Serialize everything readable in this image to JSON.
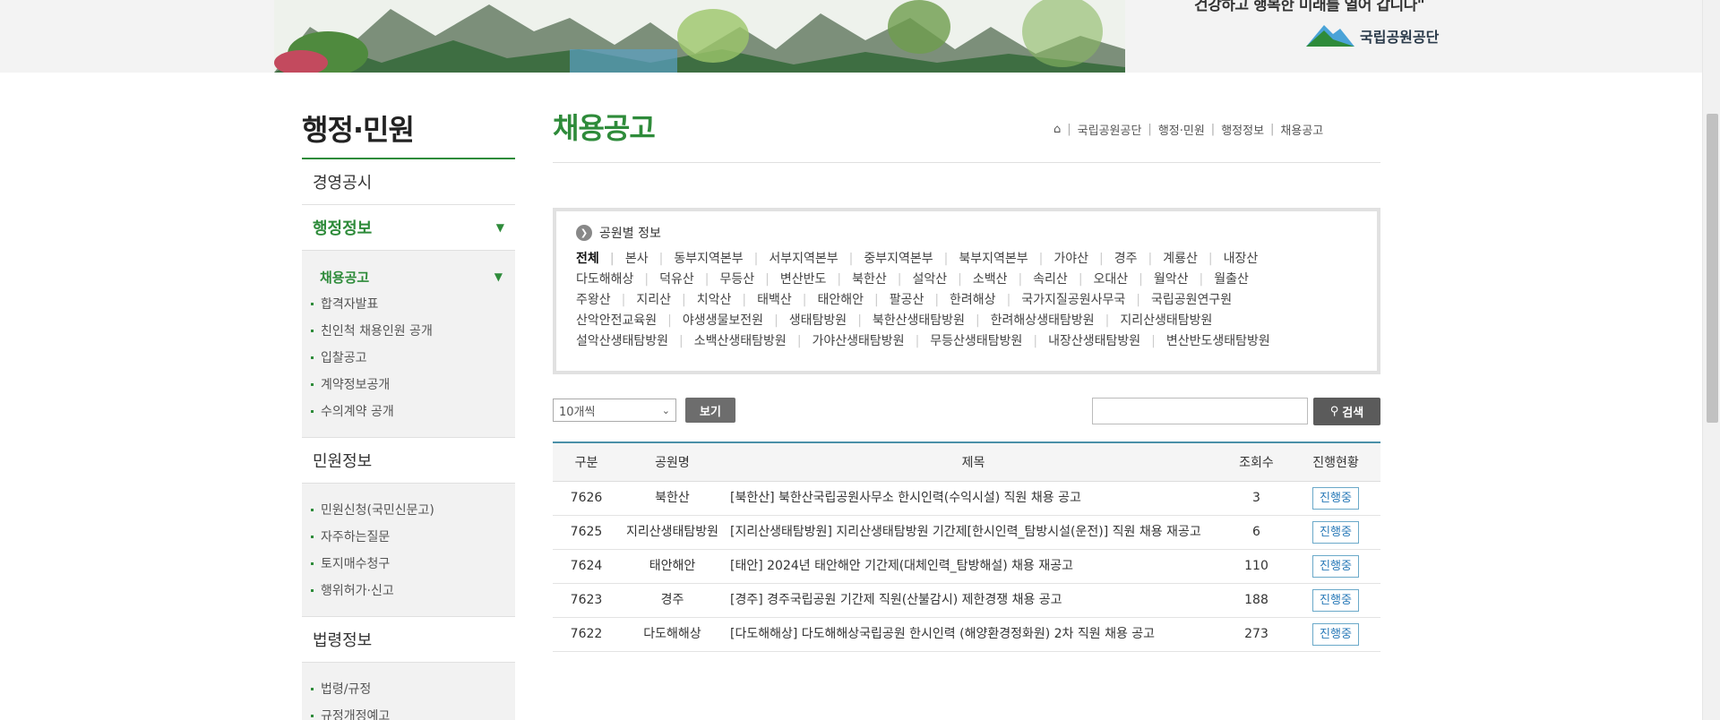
{
  "header": {
    "slogan": "건강하고 행복한 미래를 열어 갑니다\"",
    "logo_text": "국립공원공단"
  },
  "sidebar": {
    "title": "행정·민원",
    "menu": [
      {
        "label": "경영공시"
      },
      {
        "label": "행정정보"
      }
    ],
    "current_sub": "채용공고",
    "admin_items": [
      "합격자발표",
      "친인척 채용인원 공개",
      "입찰공고",
      "계약정보공개",
      "수의계약 공개"
    ],
    "civil_label": "민원정보",
    "civil_items": [
      "민원신청(국민신문고)",
      "자주하는질문",
      "토지매수청구",
      "행위허가·신고"
    ],
    "law_label": "법령정보",
    "law_items": [
      "법령/규정",
      "규정개정예고"
    ]
  },
  "main": {
    "title": "채용공고",
    "breadcrumb": [
      "국립공원공단",
      "행정·민원",
      "행정정보",
      "채용공고"
    ]
  },
  "park_filter": {
    "heading": "공원별 정보",
    "items": [
      "전체",
      "본사",
      "동부지역본부",
      "서부지역본부",
      "중부지역본부",
      "북부지역본부",
      "가야산",
      "경주",
      "계룡산",
      "내장산",
      "다도해해상",
      "덕유산",
      "무등산",
      "변산반도",
      "북한산",
      "설악산",
      "소백산",
      "속리산",
      "오대산",
      "월악산",
      "월출산",
      "주왕산",
      "지리산",
      "치악산",
      "태백산",
      "태안해안",
      "팔공산",
      "한려해상",
      "국가지질공원사무국",
      "국립공원연구원",
      "산악안전교육원",
      "야생생물보전원",
      "생태탐방원",
      "북한산생태탐방원",
      "한려해상생태탐방원",
      "지리산생태탐방원",
      "설악산생태탐방원",
      "소백산생태탐방원",
      "가야산생태탐방원",
      "무등산생태탐방원",
      "내장산생태탐방원",
      "변산반도생태탐방원"
    ],
    "selected": "전체"
  },
  "controls": {
    "page_size": "10개씩",
    "view_label": "보기",
    "search_label": "검색",
    "search_value": ""
  },
  "table": {
    "headers": [
      "구분",
      "공원명",
      "제목",
      "조회수",
      "진행현황"
    ],
    "rows": [
      {
        "no": "7626",
        "park": "북한산",
        "title": "[북한산] 북한산국립공원사무소 한시인력(수익시설) 직원 채용 공고",
        "views": "3",
        "status": "진행중"
      },
      {
        "no": "7625",
        "park": "지리산생태탐방원",
        "title": "[지리산생태탐방원] 지리산생태탐방원 기간제[한시인력_탐방시설(운전)] 직원 채용 재공고",
        "views": "6",
        "status": "진행중"
      },
      {
        "no": "7624",
        "park": "태안해안",
        "title": "[태안] 2024년 태안해안 기간제(대체인력_탐방해설) 채용 재공고",
        "views": "110",
        "status": "진행중"
      },
      {
        "no": "7623",
        "park": "경주",
        "title": "[경주] 경주국립공원 기간제 직원(산불감시) 제한경쟁 채용 공고",
        "views": "188",
        "status": "진행중"
      },
      {
        "no": "7622",
        "park": "다도해해상",
        "title": "[다도해해상] 다도해해상국립공원 한시인력 (해양환경정화원) 2차 직원 채용 공고",
        "views": "273",
        "status": "진행중"
      }
    ]
  },
  "colors": {
    "accent": "#2e8b3a",
    "table_line": "#4a90a8"
  }
}
